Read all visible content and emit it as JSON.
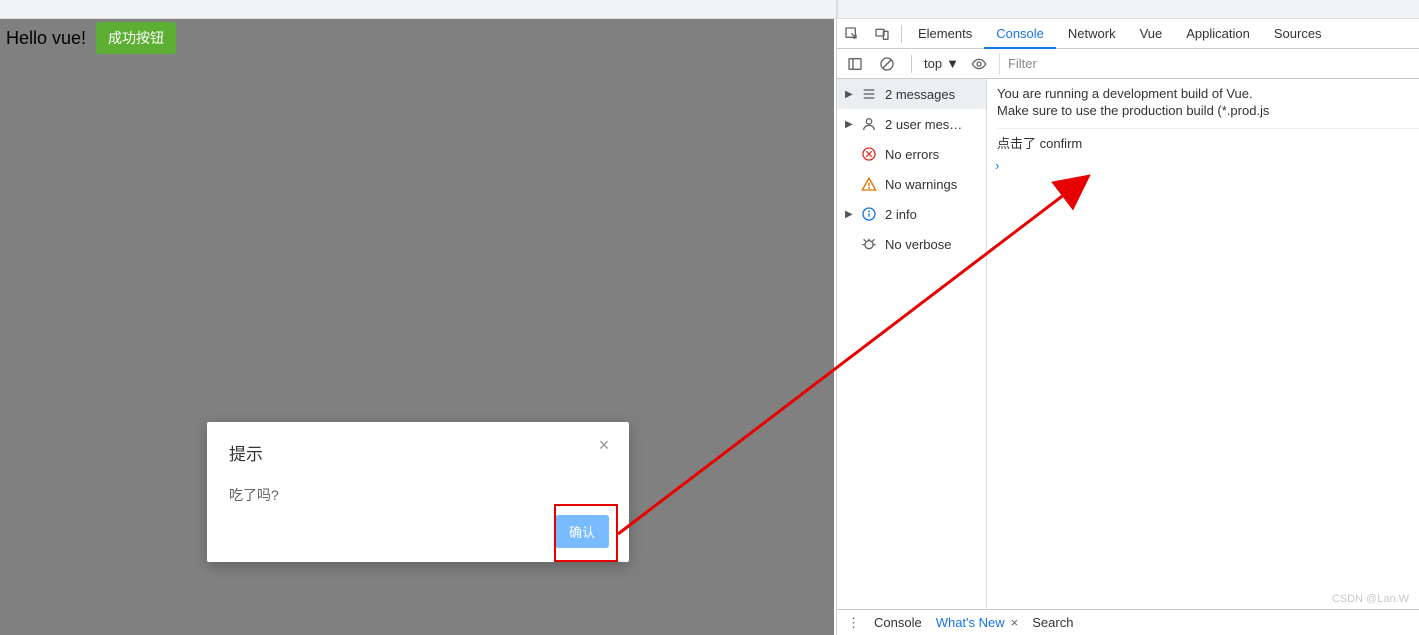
{
  "app": {
    "hello": "Hello vue!",
    "success_button": "成功按钮"
  },
  "modal": {
    "title": "提示",
    "body": "吃了吗?",
    "confirm": "确认"
  },
  "devtools": {
    "tabs": {
      "elements": "Elements",
      "console": "Console",
      "network": "Network",
      "vue": "Vue",
      "application": "Application",
      "sources": "Sources"
    },
    "toolbar": {
      "context": "top",
      "filter_placeholder": "Filter"
    },
    "sidebar": {
      "messages": "2 messages",
      "user": "2 user mes…",
      "errors": "No errors",
      "warnings": "No warnings",
      "info": "2 info",
      "verbose": "No verbose"
    },
    "log": {
      "line1": "You are running a development build of Vue.",
      "line2": "Make sure to use the production build (*.prod.js",
      "line3": "点击了 confirm"
    },
    "footer": {
      "console": "Console",
      "whatsnew": "What's New",
      "search": "Search"
    }
  },
  "watermark": "CSDN @Lan.W"
}
